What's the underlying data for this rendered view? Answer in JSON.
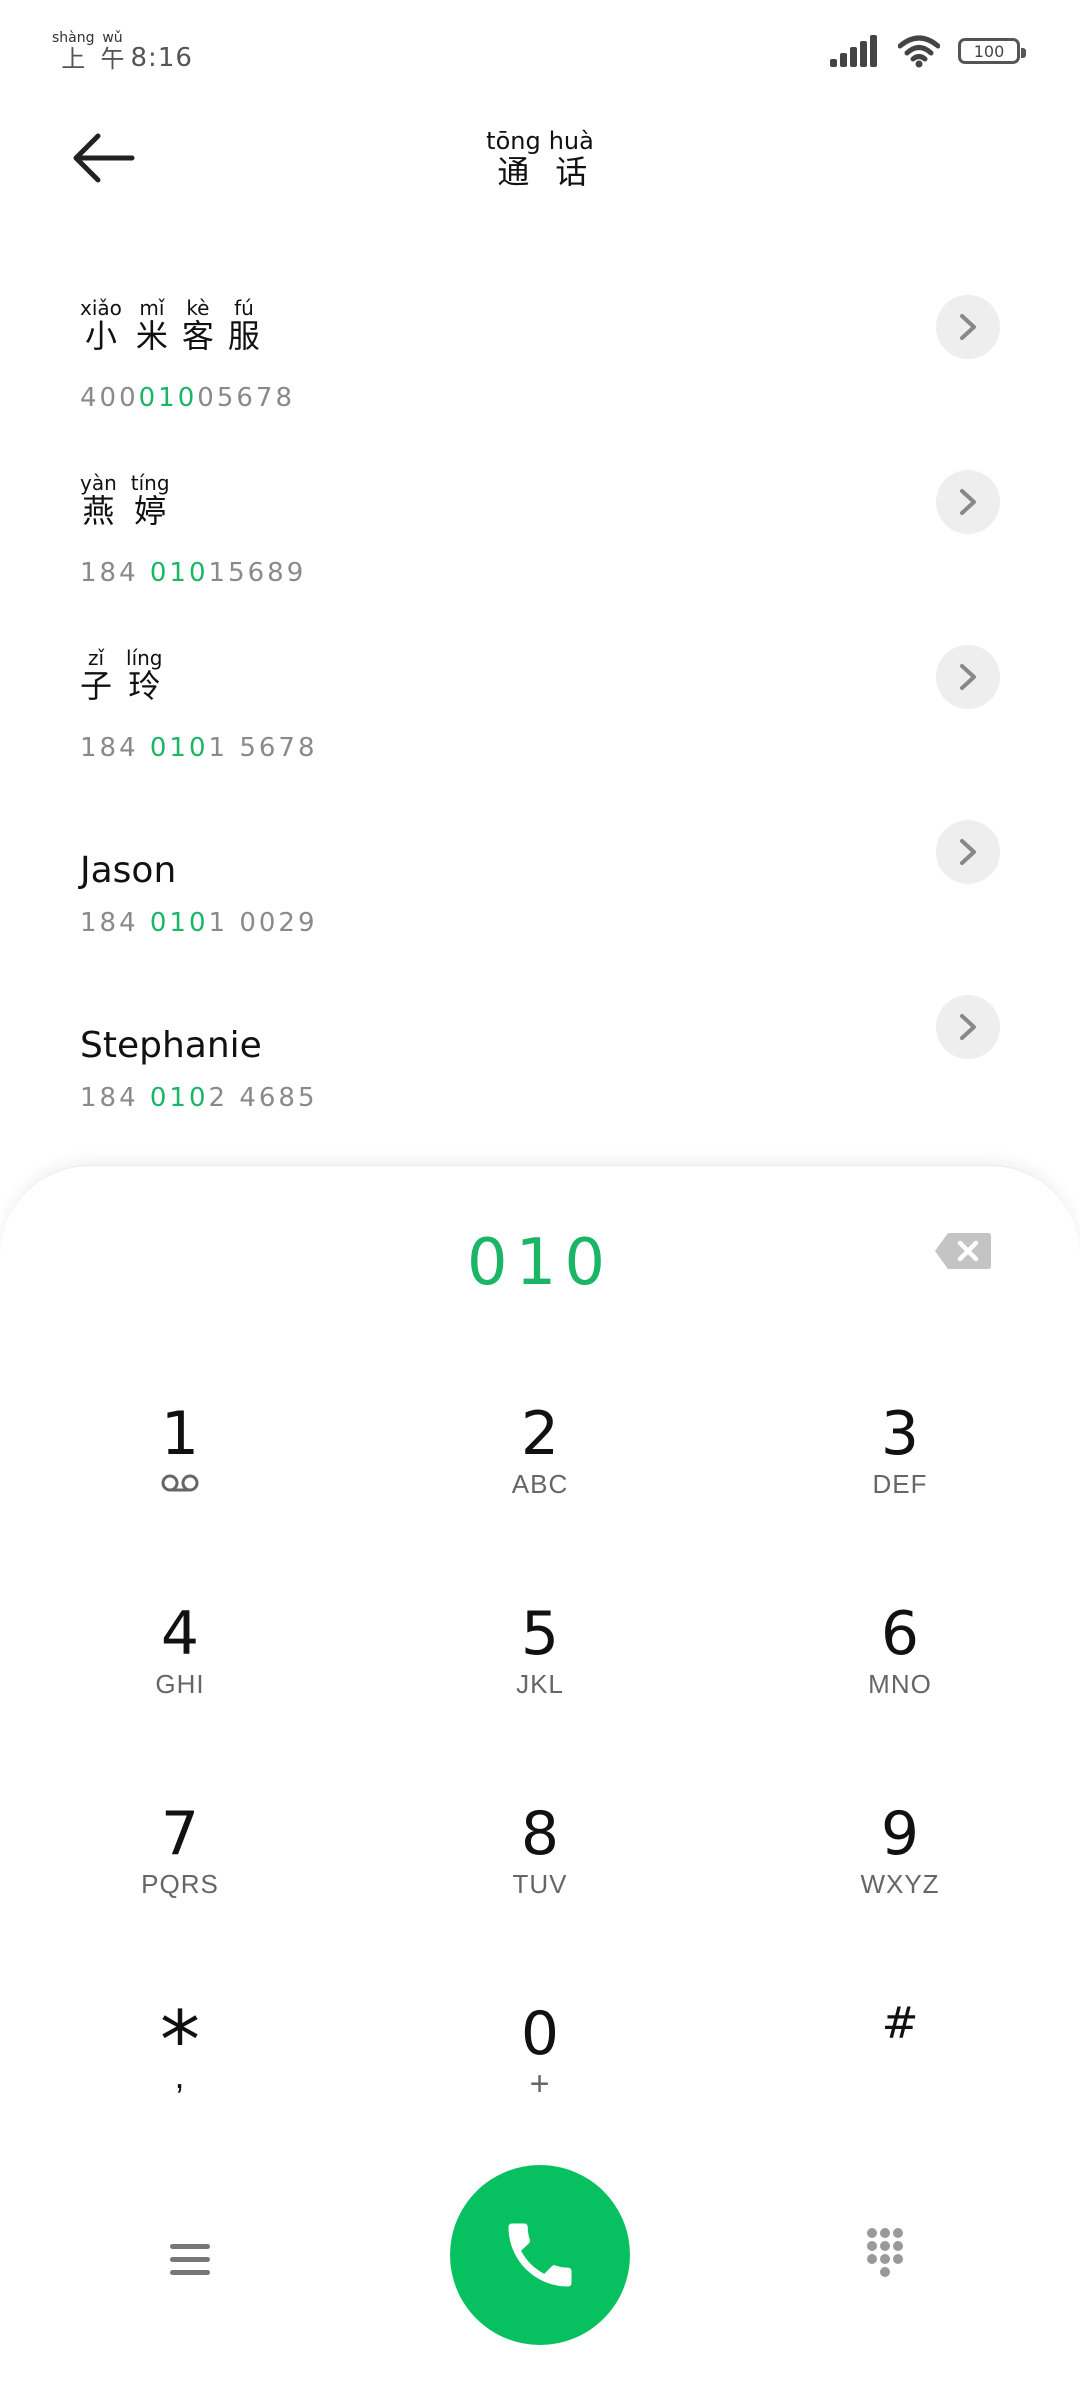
{
  "status": {
    "time_pinyin": [
      "shàng",
      "wǔ"
    ],
    "time_hanzi": [
      "上",
      "午"
    ],
    "time_digits": "8:16",
    "battery": "100"
  },
  "header": {
    "title_pinyin": [
      "tōng",
      "huà"
    ],
    "title_hanzi": [
      "通",
      "话"
    ]
  },
  "contacts": [
    {
      "pinyin": [
        "xiǎo",
        "mǐ",
        "kè",
        "fú"
      ],
      "hanzi": [
        "小",
        "米",
        "客",
        "服"
      ],
      "number_parts": [
        "400",
        "010",
        "05678"
      ]
    },
    {
      "pinyin": [
        "yàn",
        "tíng"
      ],
      "hanzi": [
        "燕",
        "婷"
      ],
      "number_parts": [
        "184 ",
        "010",
        "15689"
      ]
    },
    {
      "pinyin": [
        "zǐ",
        "líng"
      ],
      "hanzi": [
        "子",
        "玲"
      ],
      "number_parts": [
        "184 ",
        "010",
        "1 5678"
      ]
    },
    {
      "name": "Jason",
      "number_parts": [
        "184 ",
        "010",
        "1 0029"
      ]
    },
    {
      "name": "Stephanie",
      "number_parts": [
        "184 ",
        "010",
        "2 4685"
      ]
    }
  ],
  "dialer": {
    "entry": "010",
    "keys": [
      {
        "digit": "1",
        "letters": ""
      },
      {
        "digit": "2",
        "letters": "ABC"
      },
      {
        "digit": "3",
        "letters": "DEF"
      },
      {
        "digit": "4",
        "letters": "GHI"
      },
      {
        "digit": "5",
        "letters": "JKL"
      },
      {
        "digit": "6",
        "letters": "MNO"
      },
      {
        "digit": "7",
        "letters": "PQRS"
      },
      {
        "digit": "8",
        "letters": "TUV"
      },
      {
        "digit": "9",
        "letters": "WXYZ"
      },
      {
        "digit": "*",
        "letters": ","
      },
      {
        "digit": "0",
        "letters": "+"
      },
      {
        "digit": "#",
        "letters": ""
      }
    ]
  },
  "colors": {
    "accent": "#1bb566",
    "call_button": "#07c160"
  }
}
